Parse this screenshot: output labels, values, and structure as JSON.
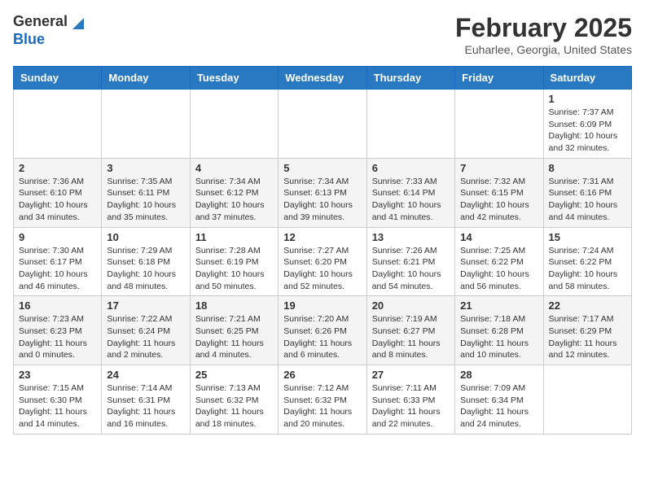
{
  "header": {
    "logo_general": "General",
    "logo_blue": "Blue",
    "month_title": "February 2025",
    "location": "Euharlee, Georgia, United States"
  },
  "days_of_week": [
    "Sunday",
    "Monday",
    "Tuesday",
    "Wednesday",
    "Thursday",
    "Friday",
    "Saturday"
  ],
  "weeks": [
    [
      {
        "day": "",
        "info": ""
      },
      {
        "day": "",
        "info": ""
      },
      {
        "day": "",
        "info": ""
      },
      {
        "day": "",
        "info": ""
      },
      {
        "day": "",
        "info": ""
      },
      {
        "day": "",
        "info": ""
      },
      {
        "day": "1",
        "info": "Sunrise: 7:37 AM\nSunset: 6:09 PM\nDaylight: 10 hours and 32 minutes."
      }
    ],
    [
      {
        "day": "2",
        "info": "Sunrise: 7:36 AM\nSunset: 6:10 PM\nDaylight: 10 hours and 34 minutes."
      },
      {
        "day": "3",
        "info": "Sunrise: 7:35 AM\nSunset: 6:11 PM\nDaylight: 10 hours and 35 minutes."
      },
      {
        "day": "4",
        "info": "Sunrise: 7:34 AM\nSunset: 6:12 PM\nDaylight: 10 hours and 37 minutes."
      },
      {
        "day": "5",
        "info": "Sunrise: 7:34 AM\nSunset: 6:13 PM\nDaylight: 10 hours and 39 minutes."
      },
      {
        "day": "6",
        "info": "Sunrise: 7:33 AM\nSunset: 6:14 PM\nDaylight: 10 hours and 41 minutes."
      },
      {
        "day": "7",
        "info": "Sunrise: 7:32 AM\nSunset: 6:15 PM\nDaylight: 10 hours and 42 minutes."
      },
      {
        "day": "8",
        "info": "Sunrise: 7:31 AM\nSunset: 6:16 PM\nDaylight: 10 hours and 44 minutes."
      }
    ],
    [
      {
        "day": "9",
        "info": "Sunrise: 7:30 AM\nSunset: 6:17 PM\nDaylight: 10 hours and 46 minutes."
      },
      {
        "day": "10",
        "info": "Sunrise: 7:29 AM\nSunset: 6:18 PM\nDaylight: 10 hours and 48 minutes."
      },
      {
        "day": "11",
        "info": "Sunrise: 7:28 AM\nSunset: 6:19 PM\nDaylight: 10 hours and 50 minutes."
      },
      {
        "day": "12",
        "info": "Sunrise: 7:27 AM\nSunset: 6:20 PM\nDaylight: 10 hours and 52 minutes."
      },
      {
        "day": "13",
        "info": "Sunrise: 7:26 AM\nSunset: 6:21 PM\nDaylight: 10 hours and 54 minutes."
      },
      {
        "day": "14",
        "info": "Sunrise: 7:25 AM\nSunset: 6:22 PM\nDaylight: 10 hours and 56 minutes."
      },
      {
        "day": "15",
        "info": "Sunrise: 7:24 AM\nSunset: 6:22 PM\nDaylight: 10 hours and 58 minutes."
      }
    ],
    [
      {
        "day": "16",
        "info": "Sunrise: 7:23 AM\nSunset: 6:23 PM\nDaylight: 11 hours and 0 minutes."
      },
      {
        "day": "17",
        "info": "Sunrise: 7:22 AM\nSunset: 6:24 PM\nDaylight: 11 hours and 2 minutes."
      },
      {
        "day": "18",
        "info": "Sunrise: 7:21 AM\nSunset: 6:25 PM\nDaylight: 11 hours and 4 minutes."
      },
      {
        "day": "19",
        "info": "Sunrise: 7:20 AM\nSunset: 6:26 PM\nDaylight: 11 hours and 6 minutes."
      },
      {
        "day": "20",
        "info": "Sunrise: 7:19 AM\nSunset: 6:27 PM\nDaylight: 11 hours and 8 minutes."
      },
      {
        "day": "21",
        "info": "Sunrise: 7:18 AM\nSunset: 6:28 PM\nDaylight: 11 hours and 10 minutes."
      },
      {
        "day": "22",
        "info": "Sunrise: 7:17 AM\nSunset: 6:29 PM\nDaylight: 11 hours and 12 minutes."
      }
    ],
    [
      {
        "day": "23",
        "info": "Sunrise: 7:15 AM\nSunset: 6:30 PM\nDaylight: 11 hours and 14 minutes."
      },
      {
        "day": "24",
        "info": "Sunrise: 7:14 AM\nSunset: 6:31 PM\nDaylight: 11 hours and 16 minutes."
      },
      {
        "day": "25",
        "info": "Sunrise: 7:13 AM\nSunset: 6:32 PM\nDaylight: 11 hours and 18 minutes."
      },
      {
        "day": "26",
        "info": "Sunrise: 7:12 AM\nSunset: 6:32 PM\nDaylight: 11 hours and 20 minutes."
      },
      {
        "day": "27",
        "info": "Sunrise: 7:11 AM\nSunset: 6:33 PM\nDaylight: 11 hours and 22 minutes."
      },
      {
        "day": "28",
        "info": "Sunrise: 7:09 AM\nSunset: 6:34 PM\nDaylight: 11 hours and 24 minutes."
      },
      {
        "day": "",
        "info": ""
      }
    ]
  ]
}
